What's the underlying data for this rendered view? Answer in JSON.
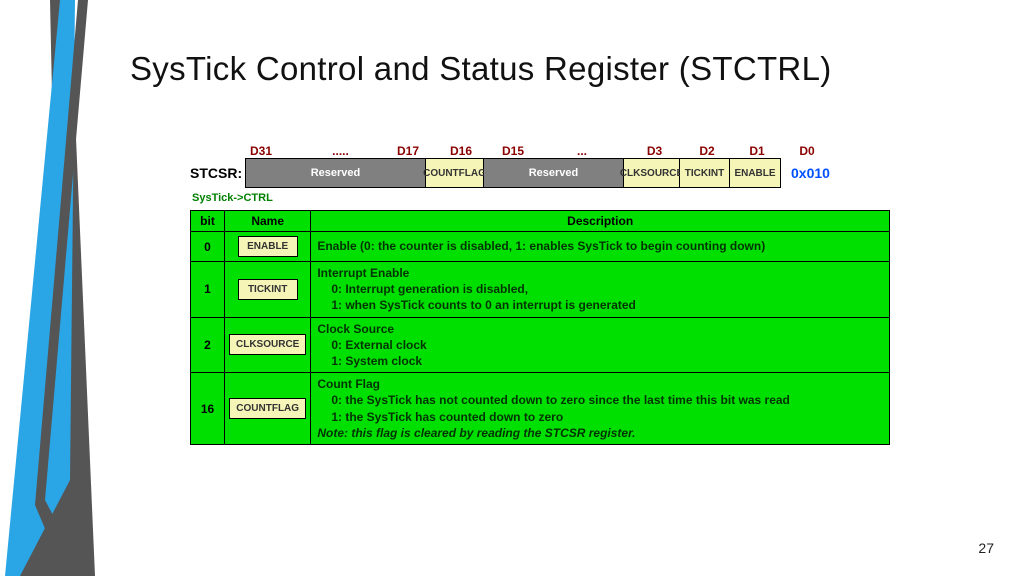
{
  "title": "SysTick Control and Status Register (STCTRL)",
  "page_number": "27",
  "bit_labels": {
    "d31": "D31",
    "dots": ".....",
    "d17": "D17",
    "d16": "D16",
    "d15": "D15",
    "dots2": "...",
    "d3": "D3",
    "d2": "D2",
    "d1": "D1",
    "d0": "D0"
  },
  "register": {
    "name_label": "STCSR:",
    "boxes": {
      "reserved1": "Reserved",
      "countflag": "COUNTFLAG",
      "reserved2": "Reserved",
      "clksource": "CLKSOURCE",
      "tickint": "TICKINT",
      "enable": "ENABLE"
    },
    "addr": "0x010",
    "subtitle": "SysTick->CTRL"
  },
  "table": {
    "headers": {
      "bit": "bit",
      "name": "Name",
      "desc": "Description"
    },
    "rows": [
      {
        "bit": "0",
        "name": "ENABLE",
        "desc_html": "Enable (0: the counter is disabled, 1: enables SysTick to begin counting down)"
      },
      {
        "bit": "1",
        "name": "TICKINT",
        "desc_l1": "Interrupt Enable",
        "desc_l2": "0: Interrupt generation is disabled,",
        "desc_l3": "1: when SysTick counts to 0 an interrupt is generated"
      },
      {
        "bit": "2",
        "name": "CLKSOURCE",
        "desc_l1": "Clock Source",
        "desc_l2": "0: External clock",
        "desc_l3": "1: System clock"
      },
      {
        "bit": "16",
        "name": "COUNTFLAG",
        "desc_l1": "Count Flag",
        "desc_l2": "0: the SysTick has not counted down to zero since the last time this bit was read",
        "desc_l3": "1: the SysTick has counted down to zero",
        "desc_note": "Note: this flag is cleared by reading the STCSR register."
      }
    ]
  }
}
